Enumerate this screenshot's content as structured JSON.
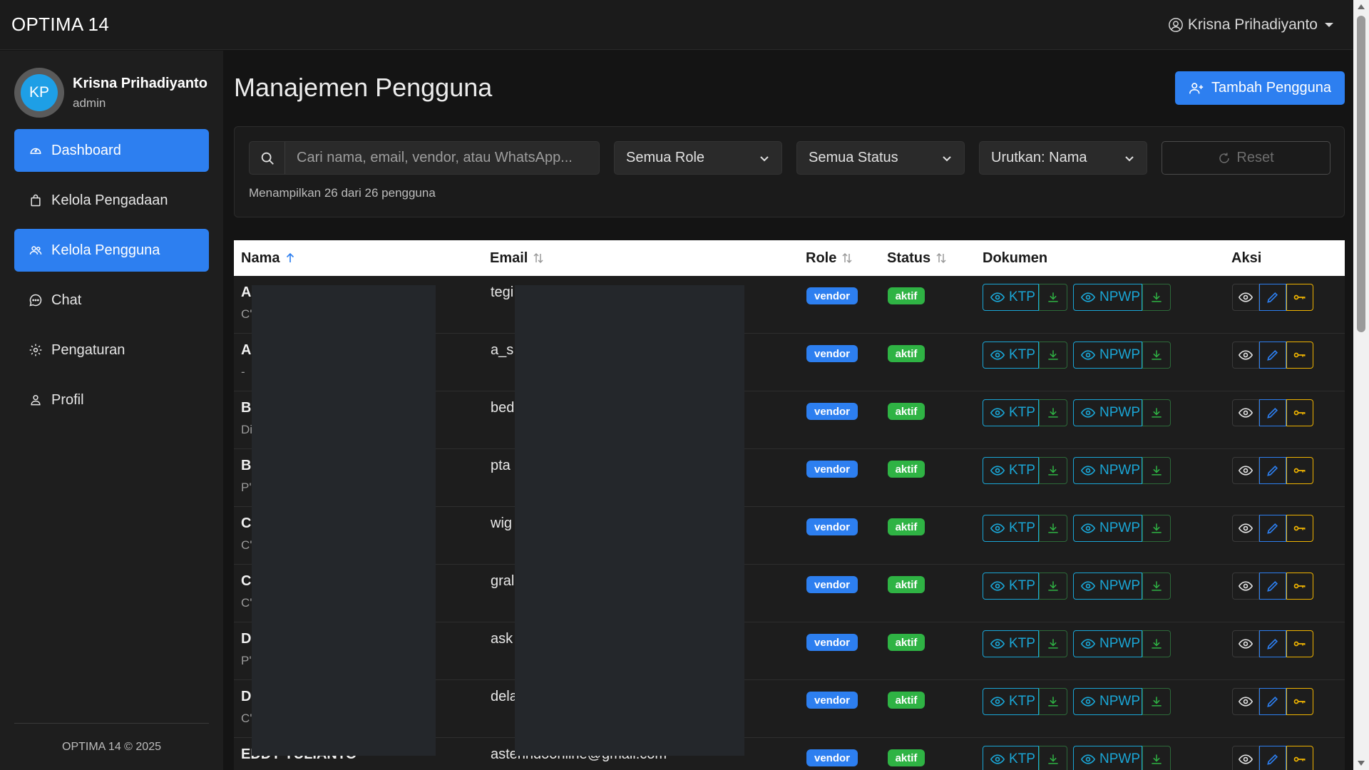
{
  "navbar": {
    "brand": "OPTIMA 14",
    "user": "Krisna Prihadiyanto"
  },
  "sidebar": {
    "profile": {
      "initials": "KP",
      "name": "Krisna Prihadiyanto",
      "role": "admin"
    },
    "items": [
      {
        "label": "Dashboard",
        "icon": "dashboard-icon",
        "active": true
      },
      {
        "label": "Kelola Pengadaan",
        "icon": "bag-icon",
        "active": false
      },
      {
        "label": "Kelola Pengguna",
        "icon": "users-icon",
        "active": true
      },
      {
        "label": "Chat",
        "icon": "chat-icon",
        "active": false
      },
      {
        "label": "Pengaturan",
        "icon": "gear-icon",
        "active": false
      },
      {
        "label": "Profil",
        "icon": "person-icon",
        "active": false
      }
    ],
    "footer": "OPTIMA 14 © 2025"
  },
  "main": {
    "title": "Manajemen Pengguna",
    "add_button": "Tambah Pengguna",
    "filters": {
      "search_placeholder": "Cari nama, email, vendor, atau WhatsApp...",
      "role_select": "Semua Role",
      "status_select": "Semua Status",
      "sort_select": "Urutkan: Nama",
      "reset": "Reset",
      "count_text": "Menampilkan 26 dari 26 pengguna"
    },
    "table": {
      "headers": {
        "nama": "Nama",
        "email": "Email",
        "role": "Role",
        "status": "Status",
        "dokumen": "Dokumen",
        "aksi": "Aksi"
      },
      "doc_labels": {
        "ktp": "KTP",
        "npwp": "NPWP"
      },
      "rows": [
        {
          "name": "A",
          "sub": "C'",
          "email": "tegi",
          "role": "vendor",
          "status": "aktif"
        },
        {
          "name": "A",
          "sub": "-",
          "email": "a_s",
          "role": "vendor",
          "status": "aktif"
        },
        {
          "name": "B",
          "sub": "Di",
          "email": "bed",
          "role": "vendor",
          "status": "aktif"
        },
        {
          "name": "B",
          "sub": "P'",
          "email": "pta",
          "role": "vendor",
          "status": "aktif"
        },
        {
          "name": "C",
          "sub": "C'",
          "email": "wig",
          "role": "vendor",
          "status": "aktif"
        },
        {
          "name": "C",
          "sub": "C'",
          "email": "gral",
          "role": "vendor",
          "status": "aktif"
        },
        {
          "name": "D",
          "sub": "P'",
          "email": "ask",
          "role": "vendor",
          "status": "aktif"
        },
        {
          "name": "D",
          "sub": "C'",
          "email": "dela",
          "role": "vendor",
          "status": "aktif"
        },
        {
          "name": "EDDY YULIANTO",
          "sub": "",
          "email": "asterindoonline@gmail.com",
          "role": "vendor",
          "status": "aktif"
        }
      ]
    }
  },
  "colors": {
    "accent": "#2d7ff0",
    "success": "#2fb344",
    "info": "#1aa6d6",
    "warning": "#f0b400"
  }
}
